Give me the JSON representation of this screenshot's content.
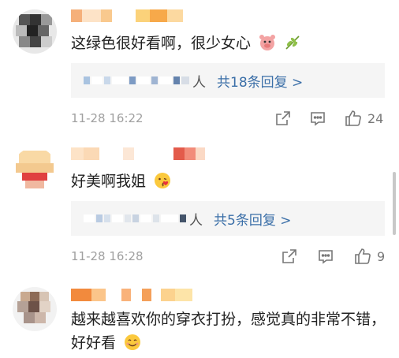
{
  "comments": [
    {
      "text": "这绿色很好看啊，很少女心",
      "reply_suffix": "人",
      "reply_link": "共18条回复 >",
      "time": "11-28 16:22",
      "likes": "24"
    },
    {
      "text": "好美啊我姐",
      "reply_suffix": "人",
      "reply_link": "共5条回复 >",
      "time": "11-28 16:28",
      "likes": "9"
    },
    {
      "text": "越来越喜欢你的穿衣打扮，感觉真的非常不错，好好看"
    }
  ],
  "icons": {
    "share": "share-icon",
    "comment": "comment-icon",
    "like": "like-icon"
  },
  "colors": {
    "link": "#3b6fa8",
    "meta": "#a0a0a0",
    "reply_bg": "#f5f5f5"
  }
}
